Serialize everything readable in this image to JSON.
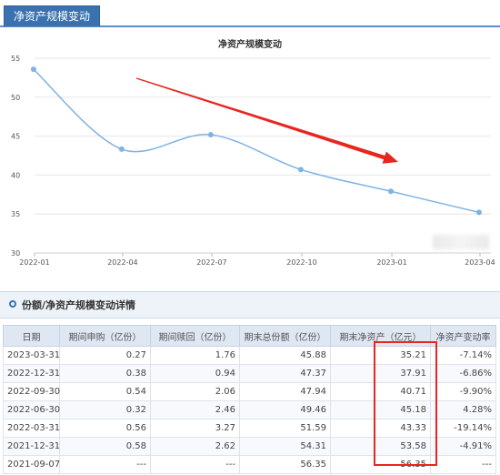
{
  "tab": {
    "label": "净资产规模变动"
  },
  "chart_data": {
    "type": "line",
    "title": "净资产规模变动",
    "categories": [
      "2022-01",
      "2022-04",
      "2022-07",
      "2022-10",
      "2023-01",
      "2023-04"
    ],
    "x_ticks": [
      "2022-01",
      "2022-04",
      "2022-07",
      "2022-10",
      "2023-01",
      "2023-04"
    ],
    "y_ticks": [
      30,
      35,
      40,
      45,
      50,
      55
    ],
    "ylim": [
      30,
      55
    ],
    "grid": true,
    "series": [
      {
        "color": "#7eb3e3",
        "points": [
          {
            "x": "2021-12-31",
            "y": 53.58
          },
          {
            "x": "2022-03-31",
            "y": 43.33
          },
          {
            "x": "2022-06-30",
            "y": 45.18
          },
          {
            "x": "2022-09-30",
            "y": 40.71
          },
          {
            "x": "2022-12-31",
            "y": 37.91
          },
          {
            "x": "2023-03-31",
            "y": 35.21
          }
        ]
      }
    ],
    "annotation": {
      "type": "arrow",
      "color": "#e8251f",
      "direction": "down-right"
    }
  },
  "detail": {
    "title": "份额/净资产规模变动详情",
    "columns": [
      "日期",
      "期间申购（亿份）",
      "期间赎回（亿份）",
      "期末总份额（亿份）",
      "期末净资产（亿元）",
      "净资产变动率"
    ],
    "rows": [
      [
        "2023-03-31",
        "0.27",
        "1.76",
        "45.88",
        "35.21",
        "-7.14%"
      ],
      [
        "2022-12-31",
        "0.38",
        "0.94",
        "47.37",
        "37.91",
        "-6.86%"
      ],
      [
        "2022-09-30",
        "0.54",
        "2.06",
        "47.94",
        "40.71",
        "-9.90%"
      ],
      [
        "2022-06-30",
        "0.32",
        "2.46",
        "49.46",
        "45.18",
        "4.28%"
      ],
      [
        "2022-03-31",
        "0.56",
        "3.27",
        "51.59",
        "43.33",
        "-19.14%"
      ],
      [
        "2021-12-31",
        "0.58",
        "2.62",
        "54.31",
        "53.58",
        "-4.91%"
      ],
      [
        "2021-09-07",
        "---",
        "---",
        "56.35",
        "56.35",
        "---"
      ]
    ],
    "highlight_color": "#e8251f"
  }
}
